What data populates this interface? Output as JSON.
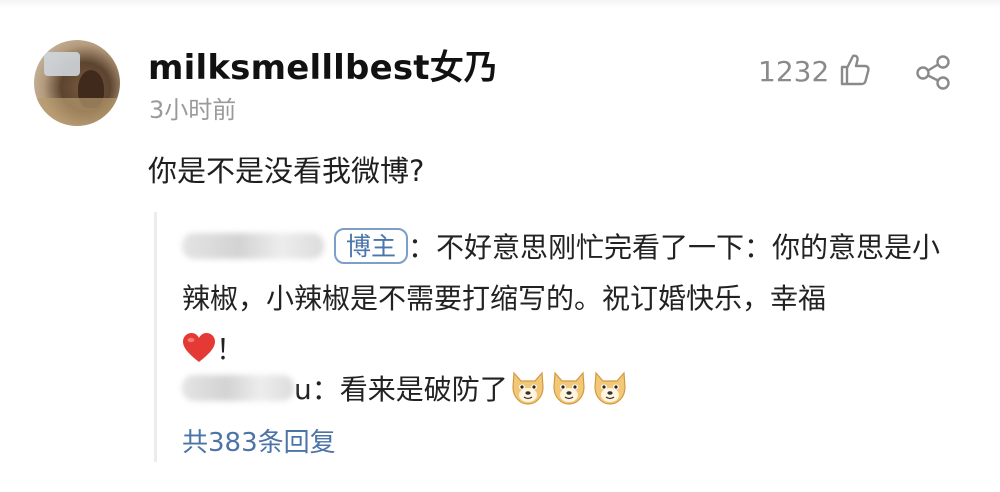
{
  "post": {
    "username": "milksmelllbest女乃",
    "timestamp": "3小时前",
    "like_count": "1232",
    "comment": "你是不是没看我微博?",
    "icons": {
      "like": "thumbs-up-icon",
      "share": "share-icon"
    }
  },
  "replies": {
    "blogger_badge": "博主",
    "reply1_text_a": "：不好意思刚忙完看了一下：你的意思是小辣椒，小辣椒是不需要打缩写的。祝订婚快乐，幸福",
    "reply1_text_b": "！",
    "reply2_name_tail": "u",
    "reply2_text": "：看来是破防了",
    "reply_count": "共383条回复"
  },
  "colors": {
    "link_blue": "#4c74a6",
    "badge_border": "#7c9ec8",
    "muted_gray": "#9a9a9a",
    "heart_red": "#e53935"
  }
}
